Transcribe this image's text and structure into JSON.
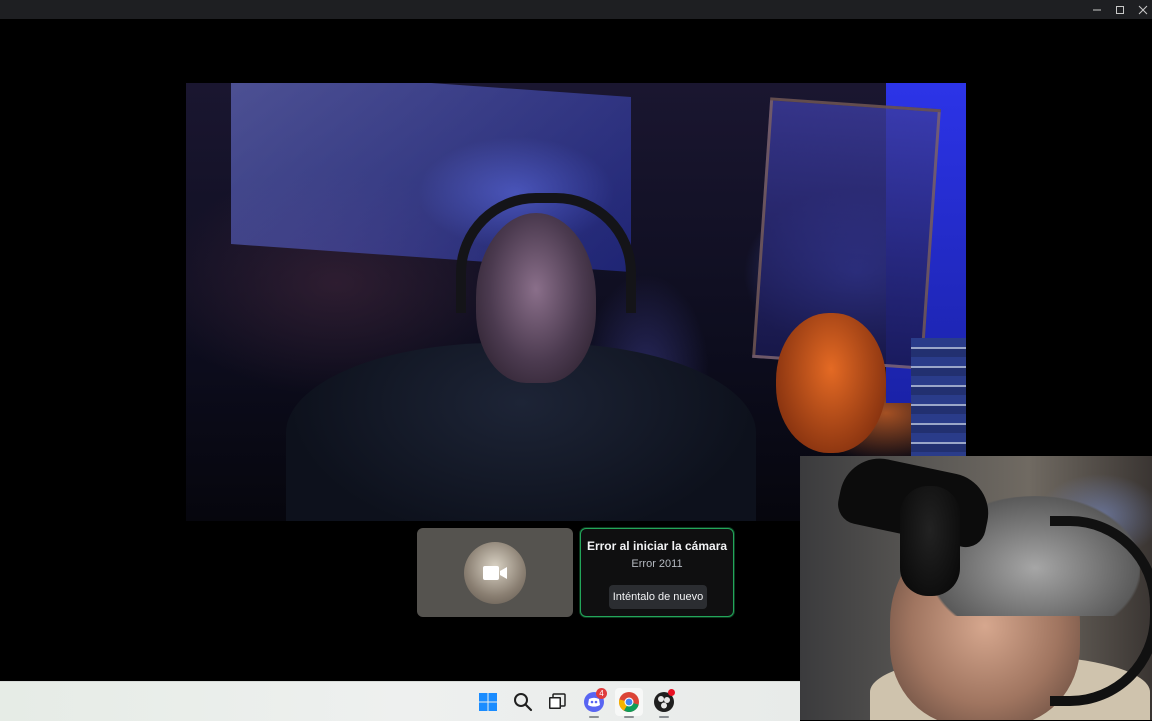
{
  "window": {
    "controls": {
      "minimize_icon": "minimize-icon",
      "maximize_icon": "maximize-icon",
      "close_icon": "close-icon"
    }
  },
  "call": {
    "self_tile": {
      "icon": "video-camera-icon",
      "avatar": "user-avatar"
    },
    "camera_error": {
      "title": "Error al iniciar la cámara",
      "code": "Error 2011",
      "retry_label": "Inténtalo de nuevo",
      "accent_color": "#23a55a"
    }
  },
  "taskbar": {
    "items": [
      {
        "name": "start",
        "icon": "windows-start-icon"
      },
      {
        "name": "search",
        "icon": "search-icon"
      },
      {
        "name": "task-view",
        "icon": "task-view-icon"
      },
      {
        "name": "discord",
        "icon": "discord-icon",
        "badge": "4"
      },
      {
        "name": "chrome",
        "icon": "chrome-icon"
      },
      {
        "name": "obs",
        "icon": "obs-icon"
      }
    ]
  }
}
